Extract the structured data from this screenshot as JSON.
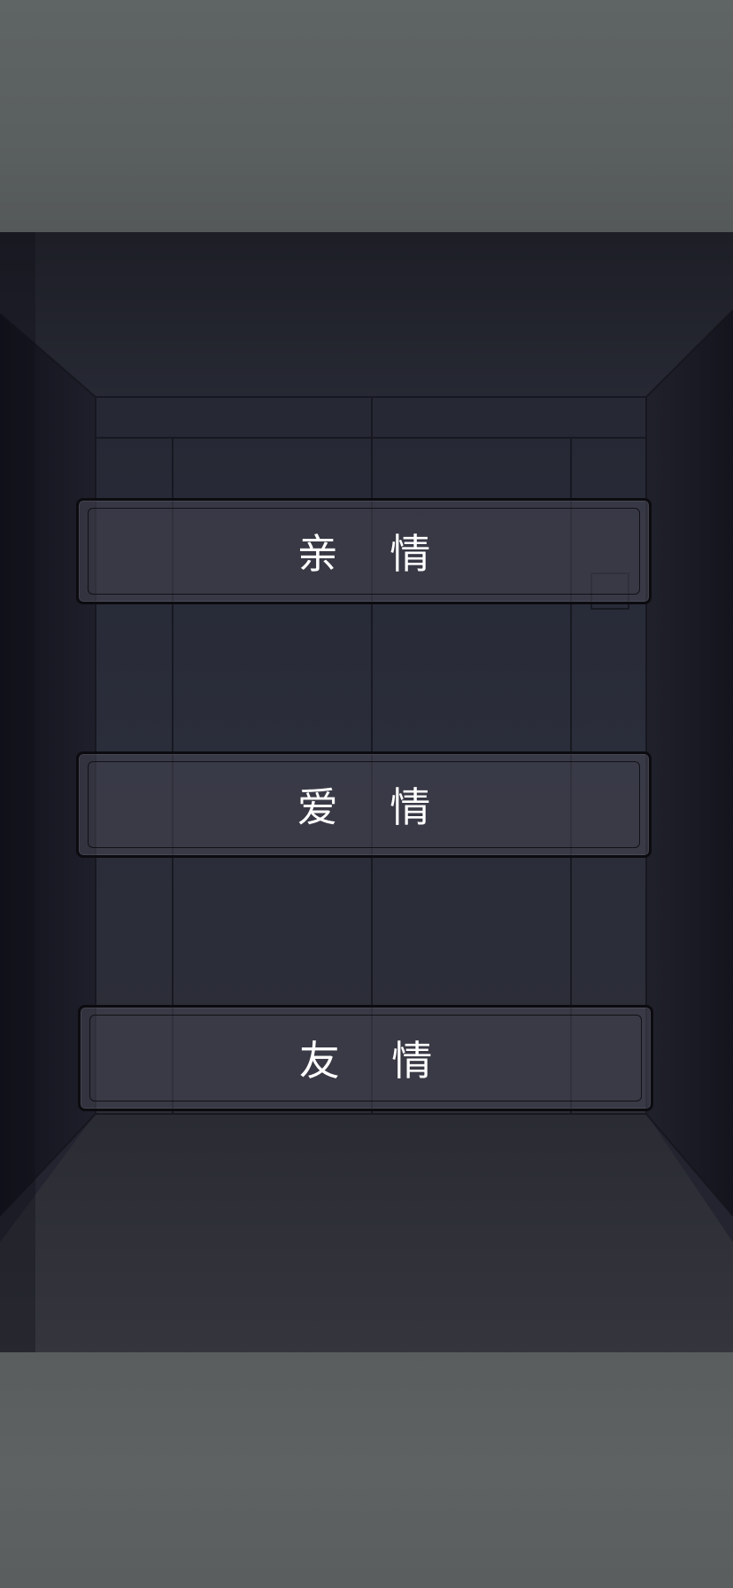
{
  "scene": {
    "choices": [
      {
        "label": "亲 情"
      },
      {
        "label": "爱 情"
      },
      {
        "label": "友 情"
      }
    ]
  },
  "colors": {
    "outer_band": "#5c6060",
    "room_dark": "#23242f",
    "button_fill": "#464652",
    "button_border": "#0b0b10",
    "label_text": "#ffffff"
  }
}
